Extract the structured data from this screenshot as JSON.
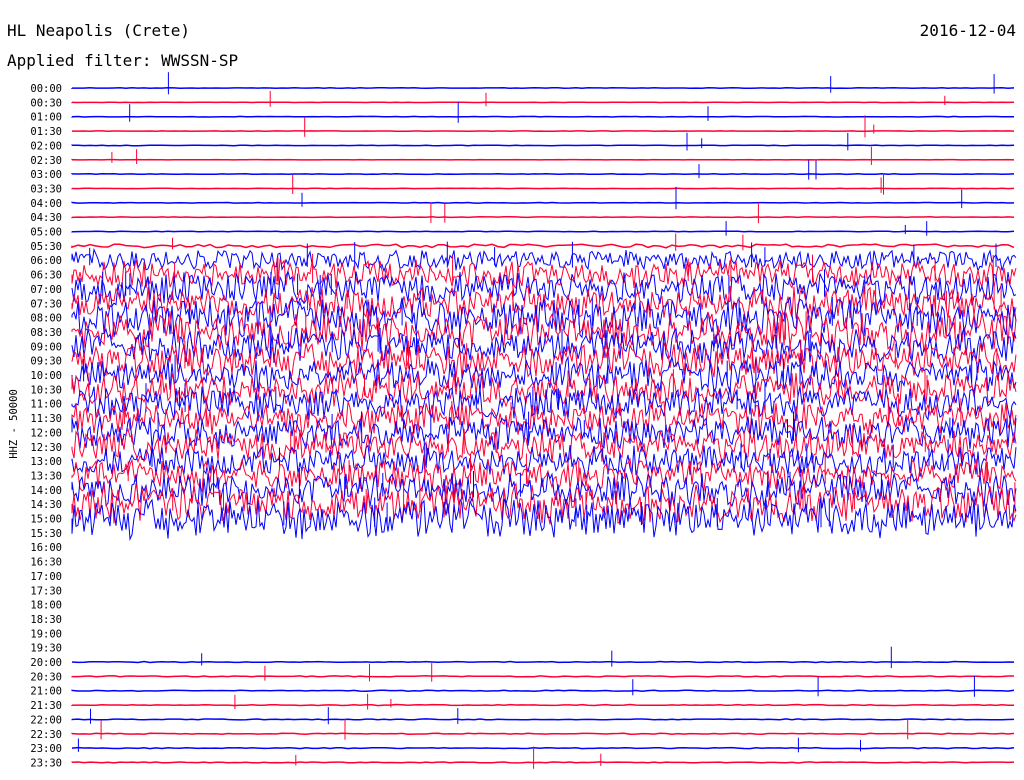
{
  "header": {
    "station": "HL Neapolis (Crete)",
    "filter": "Applied filter: WWSSN-SP",
    "date": "2016-12-04"
  },
  "chart_data": {
    "type": "helicorder",
    "title": "HL Neapolis (Crete)",
    "subtitle": "Applied filter: WWSSN-SP",
    "date": "2016-12-04",
    "ylabel": "HHZ - 50000",
    "row_labels": [
      "00:00",
      "00:30",
      "01:00",
      "01:30",
      "02:00",
      "02:30",
      "03:00",
      "03:30",
      "04:00",
      "04:30",
      "05:00",
      "05:30",
      "06:00",
      "06:30",
      "07:00",
      "07:30",
      "08:00",
      "08:30",
      "09:00",
      "09:30",
      "10:00",
      "10:30",
      "11:00",
      "11:30",
      "12:00",
      "12:30",
      "13:00",
      "13:30",
      "14:00",
      "14:30",
      "15:00",
      "15:30",
      "16:00",
      "16:30",
      "17:00",
      "17:30",
      "18:00",
      "18:30",
      "19:00",
      "19:30",
      "20:00",
      "20:30",
      "21:00",
      "21:30",
      "22:00",
      "22:30",
      "23:00",
      "23:30"
    ],
    "row_minutes": 30,
    "colors": [
      "#0000ff",
      "#ff0033"
    ],
    "trace_amplitude_relative": [
      0.05,
      0.03,
      0.05,
      0.03,
      0.05,
      0.03,
      0.05,
      0.03,
      0.05,
      0.05,
      0.05,
      0.3,
      1.6,
      2.2,
      2.6,
      2.6,
      3.0,
      3.0,
      2.8,
      2.8,
      2.6,
      2.6,
      2.6,
      2.6,
      2.6,
      2.6,
      2.4,
      2.4,
      2.6,
      3.2,
      3.2,
      0,
      0,
      0,
      0,
      0,
      0,
      0,
      0,
      0,
      0.08,
      0.08,
      0.08,
      0.08,
      0.08,
      0.08,
      0.08,
      0.08
    ],
    "gap_rows": [
      "16:00",
      "16:30",
      "17:00",
      "17:30",
      "18:00",
      "18:30",
      "19:00",
      "19:30"
    ]
  },
  "colors": {
    "trace_a": "#0000ff",
    "trace_b": "#ff0033",
    "text": "#000000",
    "background": "#ffffff"
  }
}
